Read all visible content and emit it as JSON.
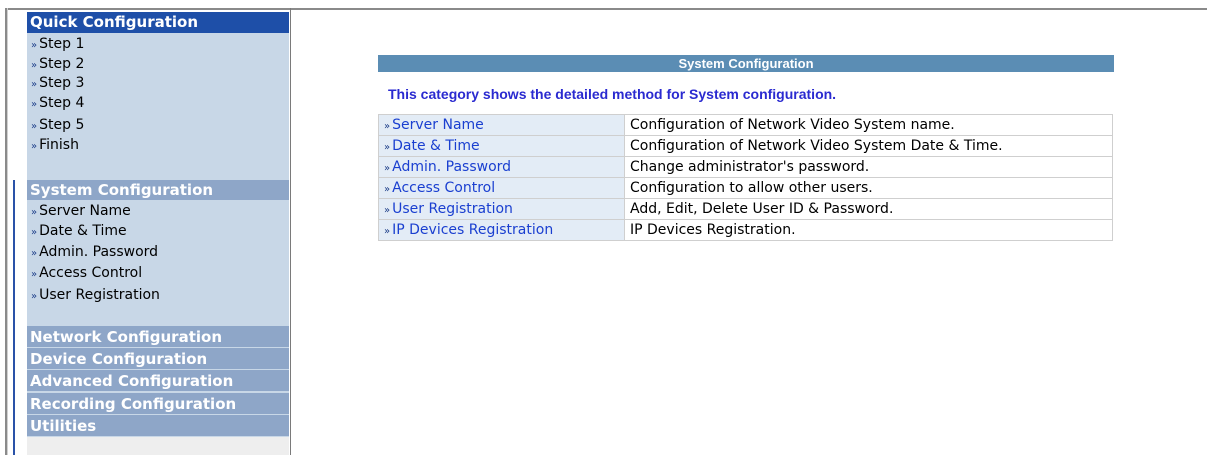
{
  "sidebar": {
    "quick": {
      "header": "Quick Configuration",
      "items": [
        "Step 1",
        "Step 2",
        "Step 3",
        "Step 4",
        "Step 5",
        "Finish"
      ]
    },
    "system": {
      "header": "System Configuration",
      "items": [
        "Server Name",
        "Date & Time",
        "Admin. Password",
        "Access Control",
        "User Registration"
      ]
    },
    "sections": [
      "Network Configuration",
      "Device Configuration",
      "Advanced Configuration",
      "Recording Configuration",
      "Utilities"
    ],
    "bullet": "»"
  },
  "main": {
    "title": "System Configuration",
    "description": "This category shows the detailed method for System configuration.",
    "rows": [
      {
        "link": "Server Name",
        "desc": "Configuration of Network Video System name."
      },
      {
        "link": "Date & Time",
        "desc": "Configuration of Network Video System Date & Time."
      },
      {
        "link": "Admin. Password",
        "desc": "Change administrator's password."
      },
      {
        "link": "Access Control",
        "desc": "Configuration to allow other users."
      },
      {
        "link": "User Registration",
        "desc": "Add, Edit, Delete User ID & Password."
      },
      {
        "link": "IP Devices Registration",
        "desc": "IP Devices Registration."
      }
    ]
  },
  "colors": {
    "active_header": "#1e4fa8",
    "section_header": "#8ea6c8",
    "sidebar_bg": "#c8d7e7",
    "title_bar": "#5b8db4",
    "link": "#1a3fd0",
    "description": "#2a2ad0"
  }
}
